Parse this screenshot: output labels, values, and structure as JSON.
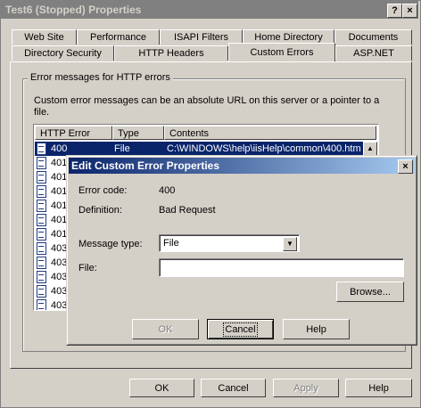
{
  "window": {
    "title": "Test6 (Stopped) Properties",
    "help_glyph": "?",
    "close_glyph": "×"
  },
  "tabs_back": [
    "Web Site",
    "Performance",
    "ISAPI Filters",
    "Home Directory",
    "Documents"
  ],
  "tabs_front": [
    "Directory Security",
    "HTTP Headers",
    "Custom Errors",
    "ASP.NET"
  ],
  "selected_tab": "Custom Errors",
  "group": {
    "label": "Error messages for HTTP errors",
    "description": "Custom error messages can be an absolute URL on this server or a pointer to a file."
  },
  "list": {
    "columns": [
      "HTTP Error",
      "Type",
      "Contents"
    ],
    "rows": [
      {
        "code": "400",
        "type": "File",
        "contents": "C:\\WINDOWS\\help\\iisHelp\\common\\400.htm",
        "selected": true
      },
      {
        "code": "401",
        "type": "",
        "contents": ""
      },
      {
        "code": "401",
        "type": "",
        "contents": ""
      },
      {
        "code": "401",
        "type": "",
        "contents": ""
      },
      {
        "code": "401",
        "type": "",
        "contents": ""
      },
      {
        "code": "401",
        "type": "",
        "contents": ""
      },
      {
        "code": "401",
        "type": "",
        "contents": ""
      },
      {
        "code": "403",
        "type": "",
        "contents": ""
      },
      {
        "code": "403",
        "type": "",
        "contents": ""
      },
      {
        "code": "403",
        "type": "",
        "contents": ""
      },
      {
        "code": "403",
        "type": "",
        "contents": ""
      },
      {
        "code": "403",
        "type": "",
        "contents": ""
      },
      {
        "code": "403",
        "type": "",
        "contents": ""
      }
    ],
    "scroll_up_glyph": "▲"
  },
  "dialog": {
    "title": "Edit Custom Error Properties",
    "close_glyph": "×",
    "error_code_label": "Error code:",
    "error_code_value": "400",
    "definition_label": "Definition:",
    "definition_value": "Bad Request",
    "message_type_label": "Message type:",
    "message_type_value": "File",
    "dropdown_glyph": "▼",
    "file_label": "File:",
    "file_value": "",
    "browse_label": "Browse...",
    "ok_label": "OK",
    "cancel_label": "Cancel",
    "help_label": "Help"
  },
  "footer": {
    "ok_label": "OK",
    "cancel_label": "Cancel",
    "apply_label": "Apply",
    "help_label": "Help"
  }
}
